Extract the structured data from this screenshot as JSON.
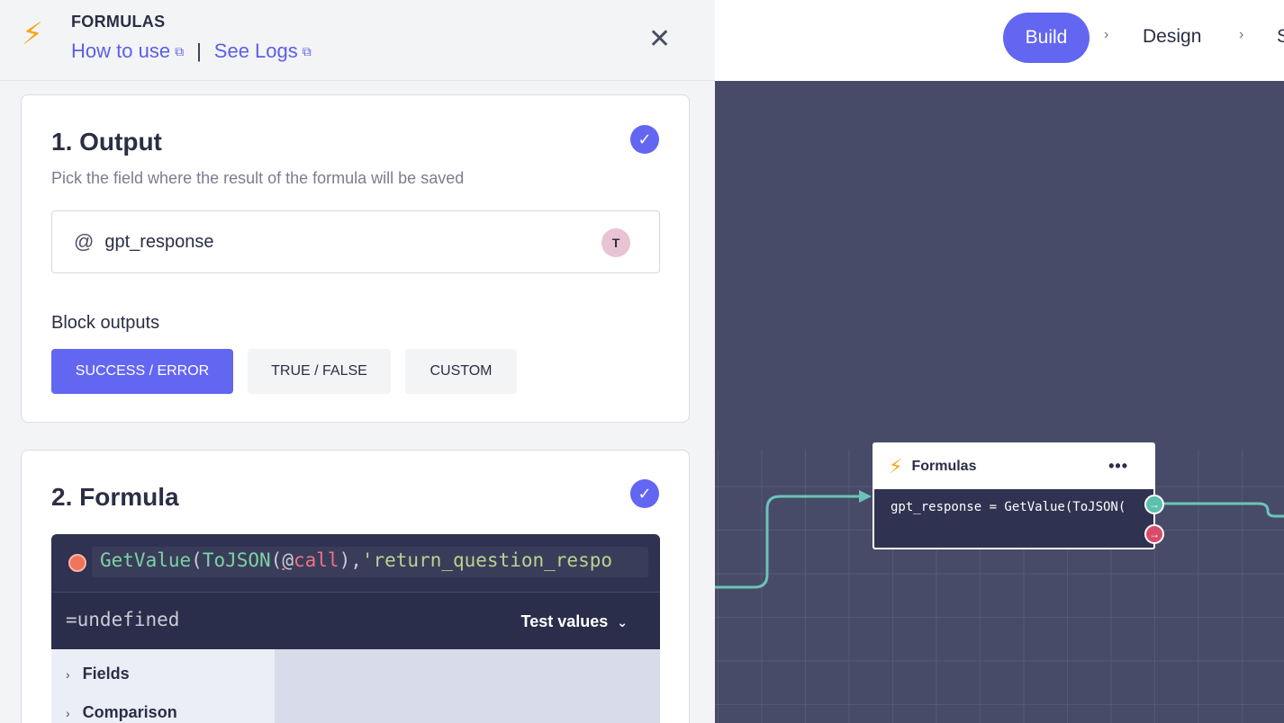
{
  "panel": {
    "kicker": "FORMULAS",
    "links": {
      "how_to_use": "How to use",
      "see_logs": "See Logs",
      "separator": "|"
    },
    "output_card": {
      "title": "1. Output",
      "subtitle": "Pick the field where the result of the formula will be saved",
      "field_prefix": "@",
      "field_value": "gpt_response",
      "field_badge": "T",
      "section_label": "Block outputs",
      "options": [
        "SUCCESS / ERROR",
        "TRUE / FALSE",
        "CUSTOM"
      ],
      "selected_option": "SUCCESS / ERROR"
    },
    "formula_card": {
      "title": "2. Formula",
      "code": {
        "fn1": "GetValue",
        "p1": "(",
        "fn2": "ToJSON",
        "p2": "(",
        "at_sym": "@",
        "var": "call",
        "p3": "),",
        "str": "'return_question_respo"
      },
      "result": "=undefined",
      "test_values": "Test values",
      "tree": [
        "Fields",
        "Comparison"
      ]
    }
  },
  "topbar": {
    "steps": [
      "Build",
      "Design",
      "S"
    ],
    "active_step": "Build",
    "separator": "›"
  },
  "node": {
    "title": "Formulas",
    "menu": "•••",
    "body": "gpt_response = GetValue(ToJSON(",
    "success_port": "→",
    "error_port": "→"
  },
  "colors": {
    "accent": "#6366f1",
    "canvas": "#474b68",
    "connector": "#6bc4b6",
    "success": "#5cc0ae",
    "error": "#d94b6a",
    "bolt": "#f7a61b"
  },
  "icons": {
    "bolt": "⚡",
    "close": "✕",
    "check": "✓",
    "external": "⧉",
    "chevron_right": "›",
    "chevron_down": "⌄"
  }
}
